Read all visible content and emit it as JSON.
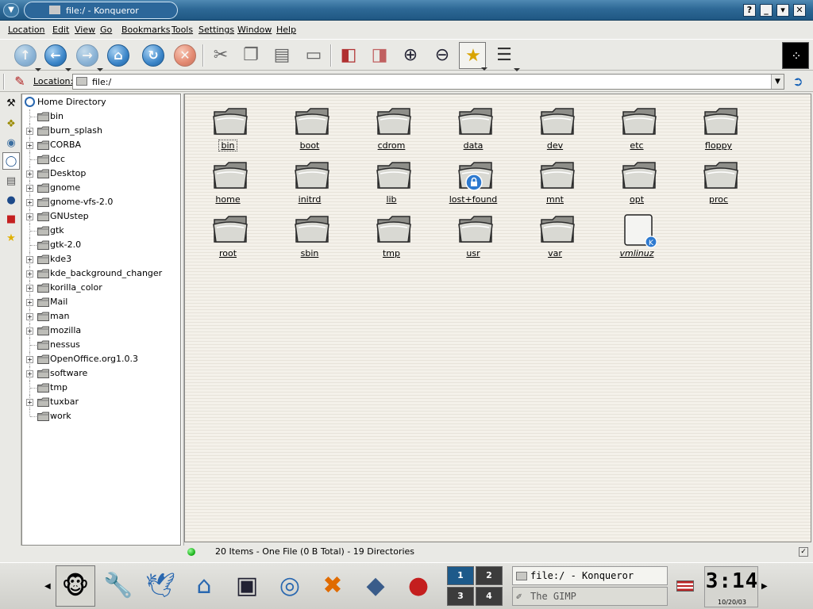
{
  "window": {
    "title": "file:/ - Konqueror",
    "menu_icon": "chevron-down-icon"
  },
  "titlebar_buttons": [
    "?",
    "_",
    "▾",
    "✕"
  ],
  "menubar": [
    "Location",
    "Edit",
    "View",
    "Go",
    "Bookmarks",
    "Tools",
    "Settings",
    "Window",
    "Help"
  ],
  "location": {
    "label": "Location:",
    "value": "file:/"
  },
  "tree": {
    "root": "Home Directory",
    "items": [
      {
        "label": "bin",
        "expandable": false
      },
      {
        "label": "burn_splash",
        "expandable": true
      },
      {
        "label": "CORBA",
        "expandable": true
      },
      {
        "label": "dcc",
        "expandable": false
      },
      {
        "label": "Desktop",
        "expandable": true
      },
      {
        "label": "gnome",
        "expandable": true
      },
      {
        "label": "gnome-vfs-2.0",
        "expandable": true
      },
      {
        "label": "GNUstep",
        "expandable": true
      },
      {
        "label": "gtk",
        "expandable": false
      },
      {
        "label": "gtk-2.0",
        "expandable": false
      },
      {
        "label": "kde3",
        "expandable": true
      },
      {
        "label": "kde_background_changer",
        "expandable": true
      },
      {
        "label": "korilla_color",
        "expandable": true
      },
      {
        "label": "Mail",
        "expandable": true
      },
      {
        "label": "man",
        "expandable": true
      },
      {
        "label": "mozilla",
        "expandable": true
      },
      {
        "label": "nessus",
        "expandable": false
      },
      {
        "label": "OpenOffice.org1.0.3",
        "expandable": true
      },
      {
        "label": "software",
        "expandable": true
      },
      {
        "label": "tmp",
        "expandable": false
      },
      {
        "label": "tuxbar",
        "expandable": true
      },
      {
        "label": "work",
        "expandable": false
      }
    ]
  },
  "files": [
    {
      "label": "bin",
      "type": "folder"
    },
    {
      "label": "boot",
      "type": "folder"
    },
    {
      "label": "cdrom",
      "type": "folder"
    },
    {
      "label": "data",
      "type": "folder"
    },
    {
      "label": "dev",
      "type": "folder"
    },
    {
      "label": "etc",
      "type": "folder"
    },
    {
      "label": "floppy",
      "type": "folder"
    },
    {
      "label": "home",
      "type": "folder"
    },
    {
      "label": "initrd",
      "type": "folder"
    },
    {
      "label": "lib",
      "type": "folder"
    },
    {
      "label": "lost+found",
      "type": "locked-folder"
    },
    {
      "label": "mnt",
      "type": "folder"
    },
    {
      "label": "opt",
      "type": "folder"
    },
    {
      "label": "proc",
      "type": "folder"
    },
    {
      "label": "root",
      "type": "folder"
    },
    {
      "label": "sbin",
      "type": "folder"
    },
    {
      "label": "tmp",
      "type": "folder"
    },
    {
      "label": "usr",
      "type": "folder"
    },
    {
      "label": "var",
      "type": "folder"
    },
    {
      "label": "vmlinuz",
      "type": "file"
    }
  ],
  "status": {
    "text": "20 Items - One File (0 B Total) - 19 Directories"
  },
  "pager": [
    "1",
    "2",
    "3",
    "4"
  ],
  "taskbar": [
    {
      "label": "file:/ - Konqueror",
      "icon": "folder-icon"
    },
    {
      "label": "The GIMP",
      "icon": "gimp-icon"
    }
  ],
  "clock": {
    "time": "3:14",
    "date": "10/20/03"
  },
  "colors": {
    "titlebar": "#2e6996",
    "accent": "#3c86c9",
    "pager_active": "#1d5a8a"
  }
}
